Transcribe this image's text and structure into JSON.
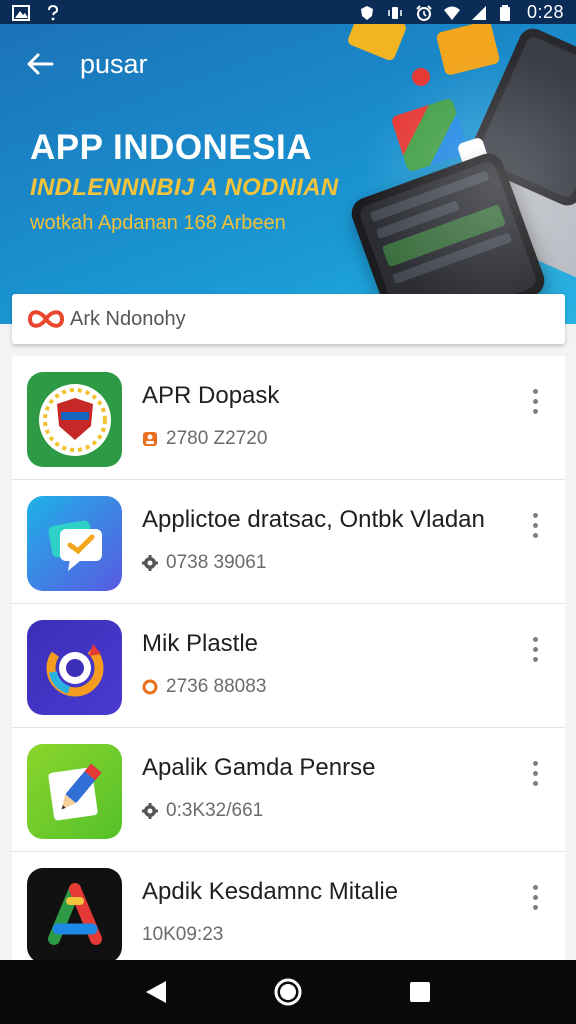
{
  "status_bar": {
    "time": "0:28",
    "left_icons": [
      "gallery-icon",
      "question-icon"
    ],
    "right_icons": [
      "shield-icon",
      "vibrate-icon",
      "alarm-icon",
      "wifi-icon",
      "signal-icon",
      "battery-icon"
    ]
  },
  "header": {
    "back_icon": "arrow-left-icon",
    "title": "pusar",
    "banner_title": "APP INDONESIA",
    "banner_subtitle": "INDLENNNBIJ A NODNIAN",
    "banner_tagline": "wotkah Apdanan 168 Arbeen"
  },
  "search": {
    "logo": "infinity-logo",
    "placeholder": "Ark Ndonohy"
  },
  "apps": [
    {
      "name": "APR Dopask",
      "meta": "2780 Z2720",
      "meta_icon": "user-icon",
      "meta_color": "#e8701f",
      "icon": "shield-badge-icon",
      "more_icon": "more-vert-icon"
    },
    {
      "name": "Applictoe dratsac, Ontbk Vladan",
      "meta": "0738 39061",
      "meta_icon": "gear-icon",
      "meta_color": "#555555",
      "icon": "chat-check-icon",
      "more_icon": "more-vert-icon"
    },
    {
      "name": "Mik Plastle",
      "meta": "2736 88083",
      "meta_icon": "ring-icon",
      "meta_color": "#e8701f",
      "icon": "refresh-ring-icon",
      "more_icon": "more-vert-icon"
    },
    {
      "name": "Apalik Gamda Penrse",
      "meta": "0:3K32/661",
      "meta_icon": "gear-icon",
      "meta_color": "#555555",
      "icon": "pencil-icon",
      "more_icon": "more-vert-icon"
    },
    {
      "name": "Apdik Kesdamnc Mitalie",
      "meta": "10K09:23",
      "meta_icon": "",
      "meta_color": "#555555",
      "icon": "triangle-logo-icon",
      "more_icon": "more-vert-icon"
    }
  ],
  "nav_bar": {
    "back": "nav-back-icon",
    "home": "nav-home-icon",
    "recents": "nav-recents-icon"
  },
  "colors": {
    "status_bar": "#0b2c57",
    "banner": "#1a86c7",
    "banner_title": "#ffffff",
    "banner_accent": "#f3c43b",
    "accent_orange": "#e8701f"
  }
}
